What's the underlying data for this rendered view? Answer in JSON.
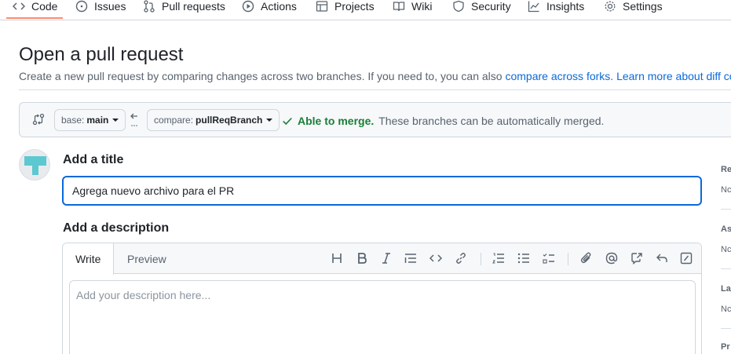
{
  "repo_nav": {
    "items": [
      {
        "label": "Code",
        "icon": "code-icon"
      },
      {
        "label": "Issues",
        "icon": "issue-opened-icon"
      },
      {
        "label": "Pull requests",
        "icon": "git-pull-request-icon"
      },
      {
        "label": "Actions",
        "icon": "play-icon"
      },
      {
        "label": "Projects",
        "icon": "table-icon"
      },
      {
        "label": "Wiki",
        "icon": "book-icon"
      },
      {
        "label": "Security",
        "icon": "shield-icon"
      },
      {
        "label": "Insights",
        "icon": "graph-icon"
      },
      {
        "label": "Settings",
        "icon": "gear-icon"
      }
    ],
    "active": "Code"
  },
  "header": {
    "title": "Open a pull request",
    "subtitle_text": "Create a new pull request by comparing changes across two branches. If you need to, you can also ",
    "link_forks": "compare across forks.",
    "link_learn": "Learn more about diff comp"
  },
  "compare": {
    "base_prefix": "base:",
    "base_branch": "main",
    "compare_prefix": "compare:",
    "compare_branch": "pullReqBranch",
    "merge_status": "Able to merge.",
    "merge_detail": "These branches can be automatically merged.",
    "merge_color": "#1a7f37"
  },
  "form": {
    "title_label": "Add a title",
    "title_value": "Agrega nuevo archivo para el PR",
    "description_label": "Add a description",
    "tabs": {
      "write": "Write",
      "preview": "Preview"
    },
    "description_placeholder": "Add your description here...",
    "toolbar": [
      "heading-icon",
      "bold-icon",
      "italic-icon",
      "quote-icon",
      "code-icon",
      "link-icon",
      "ordered-list-icon",
      "unordered-list-icon",
      "task-list-icon",
      "paperclip-icon",
      "mention-icon",
      "cross-reference-icon",
      "reply-icon",
      "slash-command-icon"
    ]
  },
  "sidebar": {
    "sections": [
      {
        "label": "Re",
        "value": "Nc"
      },
      {
        "label": "As",
        "value": "Nc"
      },
      {
        "label": "La",
        "value": "Nc"
      },
      {
        "label": "Pr",
        "value": ""
      }
    ]
  },
  "colors": {
    "accent": "#0969da",
    "success": "#1a7f37",
    "nav_active": "#fd8c73"
  }
}
